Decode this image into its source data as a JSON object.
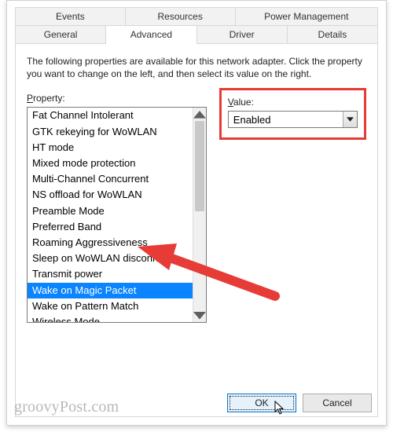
{
  "tabs_row1": [
    "Events",
    "Resources",
    "Power Management"
  ],
  "tabs_row2": [
    "General",
    "Advanced",
    "Driver",
    "Details"
  ],
  "active_tab": "Advanced",
  "instruction": "The following properties are available for this network adapter. Click the property you want to change on the left, and then select its value on the right.",
  "property_label": "Property:",
  "value_label": "Value:",
  "properties": [
    "Fat Channel Intolerant",
    "GTK rekeying for WoWLAN",
    "HT mode",
    "Mixed mode protection",
    "Multi-Channel Concurrent",
    "NS offload for WoWLAN",
    "Preamble Mode",
    "Preferred Band",
    "Roaming Aggressiveness",
    "Sleep on WoWLAN disconnect",
    "Transmit power",
    "Wake on Magic Packet",
    "Wake on Pattern Match",
    "Wireless Mode"
  ],
  "selected_property": "Wake on Magic Packet",
  "value_selected": "Enabled",
  "buttons": {
    "ok": "OK",
    "cancel": "Cancel"
  },
  "annotation_colors": {
    "highlight_box": "#e63b36",
    "arrow": "#e63b36"
  },
  "watermark": "groovyPost.com"
}
